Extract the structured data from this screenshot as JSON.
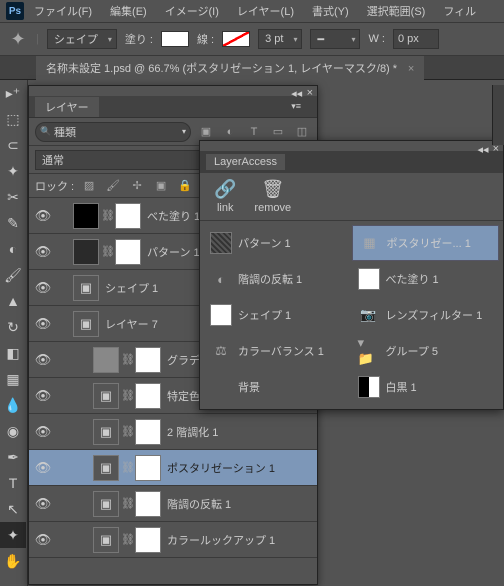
{
  "menu": {
    "items": [
      "ファイル(F)",
      "編集(E)",
      "イメージ(I)",
      "レイヤー(L)",
      "書式(Y)",
      "選択範囲(S)",
      "フィル"
    ]
  },
  "options": {
    "shape": "シェイプ",
    "fill": "塗り :",
    "stroke": "線 :",
    "pt": "3 pt",
    "w": "W :",
    "wval": "0 px"
  },
  "tab": {
    "title": "名称未設定 1.psd @ 66.7% (ポスタリゼーション 1, レイヤーマスク/8) *"
  },
  "layerpanel": {
    "tab": "レイヤー",
    "filter": "種類",
    "blend": "通常",
    "lock": "ロック :",
    "layers": [
      {
        "name": "べた塗り 1",
        "thumb": "#000",
        "mask": true,
        "link": true,
        "sel": false,
        "indent": 1
      },
      {
        "name": "パターン 1",
        "thumb": "#2a2a2a",
        "mask": true,
        "link": true,
        "sel": false,
        "indent": 1
      },
      {
        "name": "シェイプ 1",
        "thumb": "icon",
        "sel": false,
        "indent": 1
      },
      {
        "name": "レイヤー 7",
        "thumb": "icon",
        "sel": false,
        "indent": 1
      },
      {
        "name": "グラデーション",
        "thumb": "#888",
        "mask": true,
        "link": true,
        "sel": false,
        "indent": 2
      },
      {
        "name": "特定色域の選",
        "thumb": "icon",
        "mask": true,
        "link": true,
        "sel": false,
        "indent": 2
      },
      {
        "name": "2 階調化 1",
        "thumb": "icon",
        "mask": true,
        "link": true,
        "sel": false,
        "indent": 2
      },
      {
        "name": "ポスタリゼーション 1",
        "thumb": "icon",
        "mask": true,
        "link": true,
        "sel": true,
        "indent": 2
      },
      {
        "name": "階調の反転 1",
        "thumb": "icon",
        "mask": true,
        "link": true,
        "sel": false,
        "indent": 2
      },
      {
        "name": "カラールックアップ 1",
        "thumb": "icon",
        "mask": true,
        "link": true,
        "sel": false,
        "indent": 2
      }
    ]
  },
  "access": {
    "tab": "LayerAccess",
    "tools": [
      {
        "icon": "🔗",
        "label": "link"
      },
      {
        "icon": "🗑",
        "label": "remove"
      }
    ],
    "left": [
      {
        "thumb": "pattern",
        "label": "パターン 1"
      },
      {
        "ico": "◐",
        "label": "階調の反転 1"
      },
      {
        "thumb": "white",
        "label": "シェイプ 1"
      },
      {
        "ico": "⚖",
        "label": "カラーバランス 1"
      },
      {
        "plain": true,
        "label": "背景"
      }
    ],
    "right": [
      {
        "ico": "▦",
        "label": "ポスタリゼー... 1",
        "sel": true
      },
      {
        "thumb": "white",
        "label": "べた塗り 1"
      },
      {
        "ico": "📷",
        "label": "レンズフィルター 1"
      },
      {
        "ico": "▾📁",
        "label": "グループ 5"
      },
      {
        "thumb": "bw",
        "label": "白黒 1"
      }
    ]
  }
}
